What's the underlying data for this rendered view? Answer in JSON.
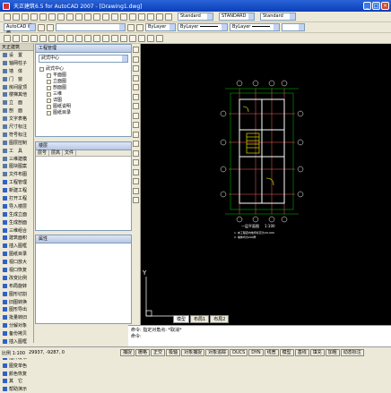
{
  "window": {
    "title": "天正建筑6.5 for AutoCAD 2007 - [Drawing1.dwg]",
    "buttons": [
      "_",
      "□",
      "×"
    ]
  },
  "toolbar_row2": {
    "autocad_combo": "AutoCAD 经典",
    "text_style": "Standard",
    "dim_style": "STANDARD",
    "table_style": "Standard"
  },
  "toolbar_row3": {
    "color_combo": "ByLayer",
    "linetype_combo": "ByLayer",
    "lineweight_combo": "ByLayer"
  },
  "left_menu": {
    "title": "天正建筑",
    "items": [
      "设　置",
      "轴网柱子",
      "墙　体",
      "门　窗",
      "房间屋顶",
      "楼梯其他",
      "立　面",
      "剖　面",
      "文字表格",
      "尺寸标注",
      "符号标注",
      "图层控制",
      "工　具",
      "三维建模",
      "图块图案",
      "文件布图",
      "工程管理",
      "新建工程",
      "打开工程",
      "导入楼层",
      "生成立面",
      "生成剖面",
      "三维组合",
      "建筑面积",
      "插入图框",
      "图纸目录",
      "视口放大",
      "视口恢复",
      "改变比例",
      "布局旋转",
      "图形切割",
      "旧图转换",
      "图形导出",
      "批量转旧",
      "分解对象",
      "备份拷贝",
      "插入图框",
      "图纸保护",
      "插件发布",
      "图变单色",
      "颜色恢复",
      "其　它",
      "帮助演示"
    ]
  },
  "project_pane": {
    "title": "工程管理",
    "project_name": "武式中心",
    "tree": [
      "武式中心",
      "平面图",
      "立面图",
      "剖面图",
      "三维",
      "详图",
      "图纸说明",
      "图纸目录"
    ]
  },
  "floor_pane": {
    "title": "楼层",
    "columns": [
      "层号",
      "层高",
      "文件"
    ],
    "bottom_title": "属性"
  },
  "drawing": {
    "plan_title": "一层平面图",
    "plan_scale": "1:100",
    "note1": "1. 本工程室内地坪标高为±0.000",
    "note2": "2. 墙体均为240厚"
  },
  "tabs": [
    "模型",
    "布局1",
    "布局2"
  ],
  "command": {
    "line1": "命令: 指定对角点: *取消*",
    "line2": "命令:"
  },
  "status": {
    "coords": "29937, -9287, 0",
    "scale": "比例 1:100",
    "buttons": [
      "捕捉",
      "栅格",
      "正交",
      "极轴",
      "对象捕捉",
      "对象追踪",
      "DUCS",
      "DYN",
      "线宽",
      "模型",
      "基线",
      "填充",
      "加粗",
      "动态标注"
    ]
  },
  "colors": {
    "canvas": "#000000",
    "wall": "#ff4040",
    "axis": "#ff6060",
    "dim": "#00ff00",
    "text": "#ffffff",
    "title_bar": "#0a3fb8"
  }
}
